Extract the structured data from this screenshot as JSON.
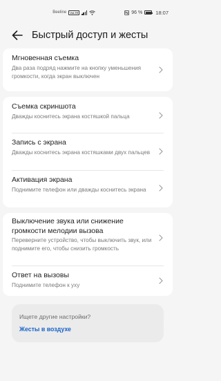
{
  "status_bar": {
    "carrier": "Beeline",
    "volte": "VoLTE",
    "battery_percent_text": "96 %",
    "battery_level": 0.96,
    "time": "18:07",
    "icons": [
      "signal-icon",
      "wifi-icon",
      "nfc-icon",
      "battery-icon"
    ]
  },
  "header": {
    "back_icon": "arrow-left-icon",
    "title": "Быстрый доступ и жесты"
  },
  "sections": [
    {
      "items": [
        {
          "title": "Мгновенная съемка",
          "desc": "Два раза подряд нажмите на кнопку уменьшения громкости, когда экран выключен"
        }
      ]
    },
    {
      "items": [
        {
          "title": "Съемка скриншота",
          "desc": "Дважды коснитесь экрана костяшкой пальца"
        },
        {
          "title": "Запись с экрана",
          "desc": "Дважды коснитесь экрана костяшками двух пальцев"
        },
        {
          "title": "Активация экрана",
          "desc": "Поднимите телефон или дважды коснитесь экрана"
        }
      ]
    },
    {
      "items": [
        {
          "title": "Выключение звука или снижение громкости мелодии вызова",
          "desc": "Переверните устройство, чтобы выключить звук, или поднимите его, чтобы снизить громкость"
        },
        {
          "title": "Ответ на вызовы",
          "desc": "Поднимите телефон к уху"
        }
      ]
    }
  ],
  "suggestion": {
    "question": "Ищете другие настройки?",
    "link": "Жесты в воздухе",
    "link_color": "#1a63c9"
  },
  "colors": {
    "background": "#f5f5f5",
    "card": "#ffffff",
    "title_text": "#1f1f1f",
    "secondary_text": "#7a7a7a",
    "accent": "#1a63c9"
  }
}
